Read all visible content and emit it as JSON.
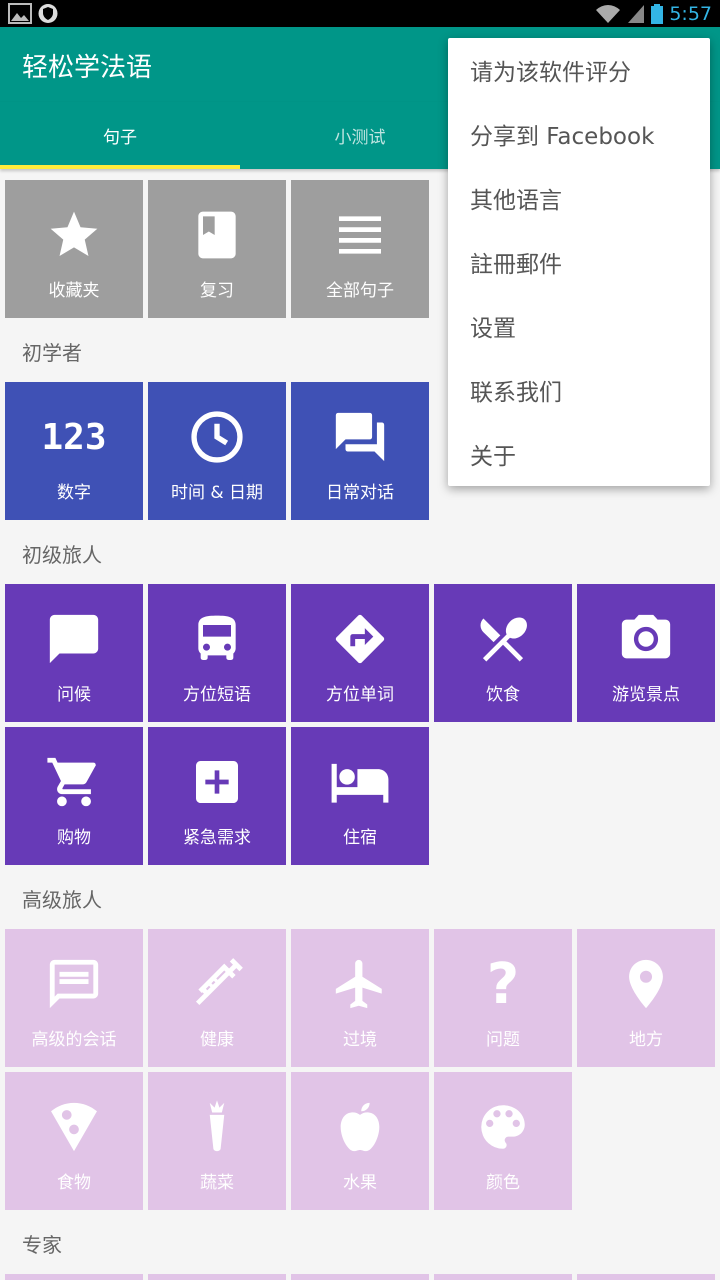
{
  "status_bar": {
    "time": "5:57"
  },
  "app": {
    "title": "轻松学法语"
  },
  "tabs": [
    {
      "label": "句子",
      "selected": true
    },
    {
      "label": "小测试",
      "selected": false
    }
  ],
  "top_tiles": [
    {
      "label": "收藏夹",
      "icon": "star-icon"
    },
    {
      "label": "复习",
      "icon": "bookmark-icon"
    },
    {
      "label": "全部句子",
      "icon": "list-icon"
    }
  ],
  "sections": {
    "beginner": {
      "title": "初学者",
      "tiles": [
        {
          "label": "数字",
          "icon": "numbers-icon",
          "glyph": "123"
        },
        {
          "label": "时间 & 日期",
          "icon": "clock-icon"
        },
        {
          "label": "日常对话",
          "icon": "chat-icon"
        }
      ]
    },
    "traveler": {
      "title": "初级旅人",
      "tiles": [
        {
          "label": "问候",
          "icon": "message-icon"
        },
        {
          "label": "方位短语",
          "icon": "bus-icon"
        },
        {
          "label": "方位单词",
          "icon": "directions-icon"
        },
        {
          "label": "饮食",
          "icon": "utensils-icon"
        },
        {
          "label": "游览景点",
          "icon": "camera-icon"
        },
        {
          "label": "购物",
          "icon": "cart-icon"
        },
        {
          "label": "紧急需求",
          "icon": "medical-icon"
        },
        {
          "label": "住宿",
          "icon": "bed-icon"
        }
      ]
    },
    "advanced": {
      "title": "高级旅人",
      "tiles": [
        {
          "label": "高级的会话",
          "icon": "comment-icon"
        },
        {
          "label": "健康",
          "icon": "syringe-icon"
        },
        {
          "label": "过境",
          "icon": "airplane-icon"
        },
        {
          "label": "问题",
          "icon": "question-icon",
          "glyph": "?"
        },
        {
          "label": "地方",
          "icon": "place-icon"
        },
        {
          "label": "食物",
          "icon": "pizza-icon"
        },
        {
          "label": "蔬菜",
          "icon": "carrot-icon"
        },
        {
          "label": "水果",
          "icon": "apple-icon"
        },
        {
          "label": "颜色",
          "icon": "palette-icon"
        }
      ]
    },
    "expert": {
      "title": "专家"
    }
  },
  "overflow_menu": {
    "items": [
      "请为该软件评分",
      "分享到 Facebook",
      "其他语言",
      "註冊郵件",
      "设置",
      "联系我们",
      "关于"
    ]
  },
  "colors": {
    "primary": "#009688",
    "tab_indicator": "#ffeb3b",
    "tile_gray": "#9e9e9e",
    "tile_blue": "#3f51b5",
    "tile_purple": "#673ab7",
    "tile_lilac": "#e1c4e7"
  }
}
